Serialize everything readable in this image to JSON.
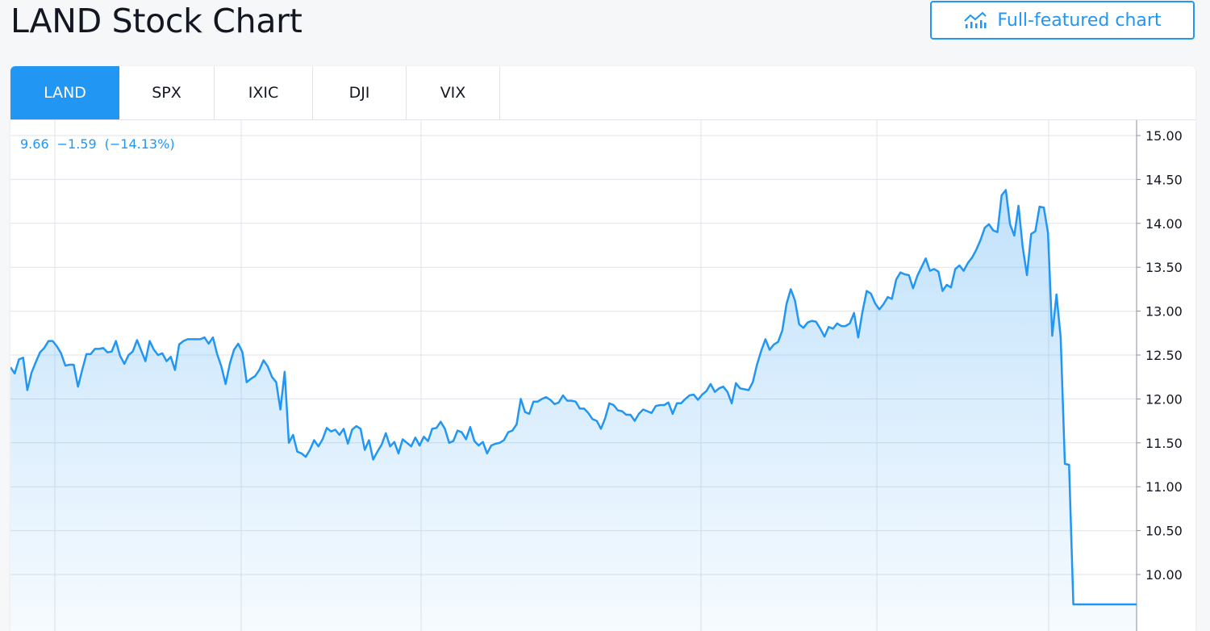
{
  "header": {
    "title": "LAND Stock Chart",
    "full_chart_label": "Full-featured chart",
    "full_chart_icon": "chart-line-icon"
  },
  "tabs": [
    {
      "label": "LAND",
      "active": true
    },
    {
      "label": "SPX",
      "active": false
    },
    {
      "label": "IXIC",
      "active": false
    },
    {
      "label": "DJI",
      "active": false
    },
    {
      "label": "VIX",
      "active": false
    }
  ],
  "readout": {
    "price": "9.66",
    "change": "−1.59",
    "change_pct": "(−14.13%)"
  },
  "colors": {
    "accent": "#2196f3",
    "grid": "#e0e3eb",
    "text": "#131722"
  },
  "chart_data": {
    "type": "area",
    "y_ticks": [
      "15.00",
      "14.50",
      "14.00",
      "13.50",
      "13.00",
      "12.50",
      "12.00",
      "11.50",
      "11.00",
      "10.50",
      "10.00"
    ],
    "ylim": [
      9.8,
      15.1
    ],
    "grid": true,
    "values": [
      12.36,
      12.29,
      12.45,
      12.47,
      12.1,
      12.3,
      12.42,
      12.53,
      12.58,
      12.66,
      12.66,
      12.6,
      12.52,
      12.38,
      12.39,
      12.39,
      12.14,
      12.33,
      12.51,
      12.51,
      12.57,
      12.57,
      12.58,
      12.53,
      12.54,
      12.66,
      12.49,
      12.4,
      12.5,
      12.54,
      12.67,
      12.55,
      12.43,
      12.66,
      12.56,
      12.5,
      12.52,
      12.43,
      12.48,
      12.33,
      12.62,
      12.66,
      12.68,
      12.68,
      12.68,
      12.68,
      12.7,
      12.63,
      12.7,
      12.51,
      12.37,
      12.17,
      12.4,
      12.56,
      12.63,
      12.53,
      12.19,
      12.23,
      12.26,
      12.33,
      12.44,
      12.37,
      12.25,
      12.19,
      11.88,
      12.31,
      11.5,
      11.59,
      11.4,
      11.38,
      11.34,
      11.42,
      11.53,
      11.46,
      11.54,
      11.67,
      11.63,
      11.65,
      11.59,
      11.66,
      11.49,
      11.65,
      11.69,
      11.66,
      11.42,
      11.53,
      11.31,
      11.4,
      11.48,
      11.61,
      11.46,
      11.51,
      11.38,
      11.54,
      11.5,
      11.46,
      11.56,
      11.47,
      11.57,
      11.52,
      11.66,
      11.67,
      11.74,
      11.66,
      11.5,
      11.52,
      11.64,
      11.62,
      11.54,
      11.68,
      11.52,
      11.47,
      11.51,
      11.38,
      11.47,
      11.49,
      11.5,
      11.53,
      11.62,
      11.64,
      11.71,
      12.0,
      11.85,
      11.83,
      11.97,
      11.97,
      12.0,
      12.02,
      11.99,
      11.94,
      11.96,
      12.04,
      11.98,
      11.98,
      11.97,
      11.89,
      11.89,
      11.84,
      11.77,
      11.75,
      11.66,
      11.78,
      11.95,
      11.93,
      11.87,
      11.86,
      11.82,
      11.82,
      11.75,
      11.83,
      11.88,
      11.86,
      11.84,
      11.92,
      11.93,
      11.93,
      11.96,
      11.83,
      11.95,
      11.95,
      12.0,
      12.04,
      12.05,
      11.99,
      12.05,
      12.09,
      12.17,
      12.08,
      12.12,
      12.14,
      12.08,
      11.95,
      12.18,
      12.12,
      12.11,
      12.1,
      12.19,
      12.39,
      12.55,
      12.68,
      12.56,
      12.62,
      12.65,
      12.78,
      13.08,
      13.25,
      13.12,
      12.85,
      12.81,
      12.87,
      12.89,
      12.88,
      12.8,
      12.71,
      12.82,
      12.8,
      12.86,
      12.83,
      12.83,
      12.86,
      12.98,
      12.7,
      12.99,
      13.23,
      13.2,
      13.09,
      13.02,
      13.08,
      13.16,
      13.14,
      13.36,
      13.44,
      13.42,
      13.41,
      13.26,
      13.4,
      13.5,
      13.6,
      13.46,
      13.48,
      13.45,
      13.23,
      13.3,
      13.27,
      13.48,
      13.52,
      13.46,
      13.55,
      13.61,
      13.7,
      13.81,
      13.95,
      13.99,
      13.92,
      13.9,
      14.32,
      14.38,
      13.99,
      13.86,
      14.2,
      13.73,
      13.41,
      13.88,
      13.91,
      14.19,
      14.18,
      13.89,
      12.72,
      13.19,
      12.7,
      11.26,
      11.25,
      9.66,
      9.66,
      9.66,
      9.66,
      9.66,
      9.66,
      9.66,
      9.66,
      9.66,
      9.66,
      9.66,
      9.66,
      9.66,
      9.66,
      9.66,
      9.66
    ]
  }
}
